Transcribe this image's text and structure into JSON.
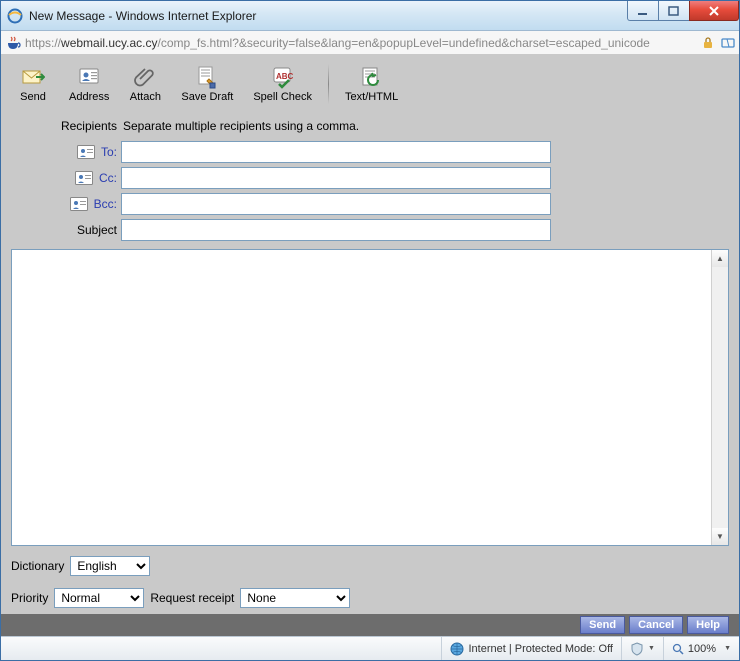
{
  "window": {
    "title": "New Message - Windows Internet Explorer",
    "url_prefix": "https://",
    "url_host": "webmail.ucy.ac.cy",
    "url_path": "/comp_fs.html?&security=false&lang=en&popupLevel=undefined&charset=escaped_unicode"
  },
  "toolbar": {
    "send": "Send",
    "address": "Address",
    "attach": "Attach",
    "save_draft": "Save Draft",
    "spell_check": "Spell Check",
    "text_html": "Text/HTML"
  },
  "fields": {
    "recipients_label": "Recipients",
    "recipients_hint": "Separate multiple recipients using a comma.",
    "to_label": "To:",
    "cc_label": "Cc:",
    "bcc_label": "Bcc:",
    "subject_label": "Subject",
    "to_value": "",
    "cc_value": "",
    "bcc_value": "",
    "subject_value": ""
  },
  "body": {
    "value": ""
  },
  "dictionary": {
    "label": "Dictionary",
    "options": [
      "English"
    ],
    "selected": "English"
  },
  "priority": {
    "label": "Priority",
    "options": [
      "Normal"
    ],
    "selected": "Normal"
  },
  "receipt": {
    "label": "Request receipt",
    "options": [
      "None"
    ],
    "selected": "None"
  },
  "actions": {
    "send": "Send",
    "cancel": "Cancel",
    "help": "Help"
  },
  "statusbar": {
    "zone": "Internet | Protected Mode: Off",
    "zoom": "100%"
  }
}
